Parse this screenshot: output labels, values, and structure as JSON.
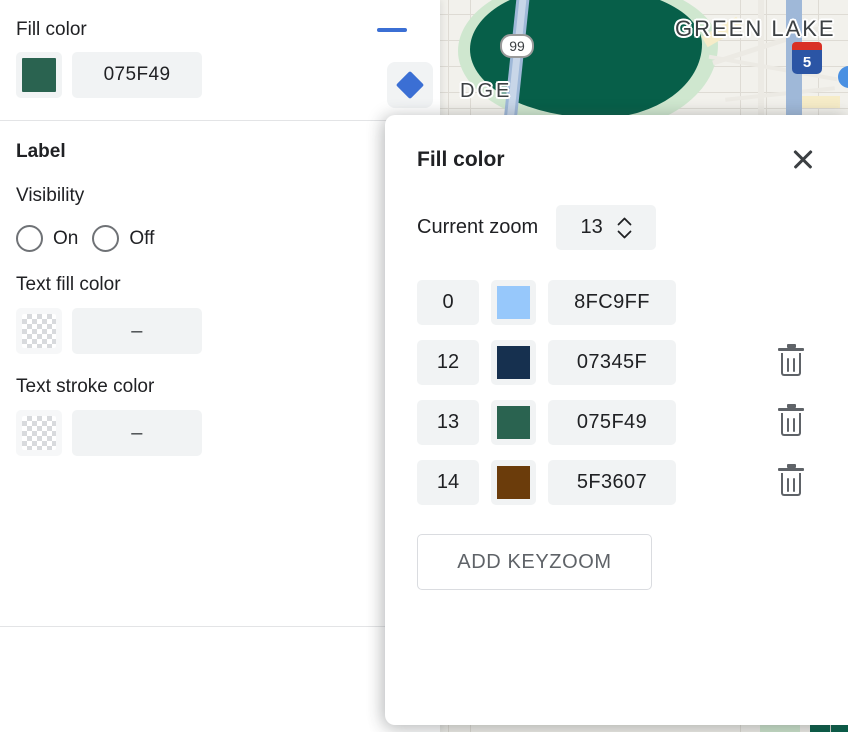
{
  "left_panel": {
    "fill_color": {
      "title": "Fill color",
      "collapse_icon": "minus-icon",
      "swatch_color": "#2a6350",
      "hex_value": "075F49"
    },
    "label_section": {
      "heading": "Label",
      "visibility_label": "Visibility",
      "visibility_options": [
        {
          "label": "On",
          "selected": false
        },
        {
          "label": "Off",
          "selected": false
        }
      ],
      "text_fill_color": {
        "label": "Text fill color",
        "swatch": "transparent-checker",
        "value": "–"
      },
      "text_stroke_color": {
        "label": "Text stroke color",
        "swatch": "transparent-checker",
        "value": "–"
      }
    },
    "diamond_button_icon": "diamond-icon",
    "accent_color": "#3b6fd4"
  },
  "dialog": {
    "title": "Fill color",
    "close_icon": "close-icon",
    "current_zoom_label": "Current zoom",
    "current_zoom_value": "13",
    "stepper_icons": [
      "chevron-up-icon",
      "chevron-down-icon"
    ],
    "keyzoom_rows": [
      {
        "zoom": "0",
        "color": "#97c8fb",
        "hex": "8FC9FF",
        "deletable": false
      },
      {
        "zoom": "12",
        "color": "#16304f",
        "hex": "07345F",
        "deletable": true
      },
      {
        "zoom": "13",
        "color": "#2a6350",
        "hex": "075F49",
        "deletable": true
      },
      {
        "zoom": "14",
        "color": "#6b3c0b",
        "hex": "5F3607",
        "deletable": true
      }
    ],
    "add_button_label": "ADD KEYZOOM"
  },
  "map": {
    "labels": [
      {
        "text": "GREEN LAKE",
        "name": "map-label-green-lake"
      },
      {
        "text": "DGE",
        "name": "map-label-dge"
      }
    ],
    "highway_shield": "99",
    "interstate_shield": "5",
    "water_color": "#075f49",
    "park_color": "#cfe7cf"
  }
}
